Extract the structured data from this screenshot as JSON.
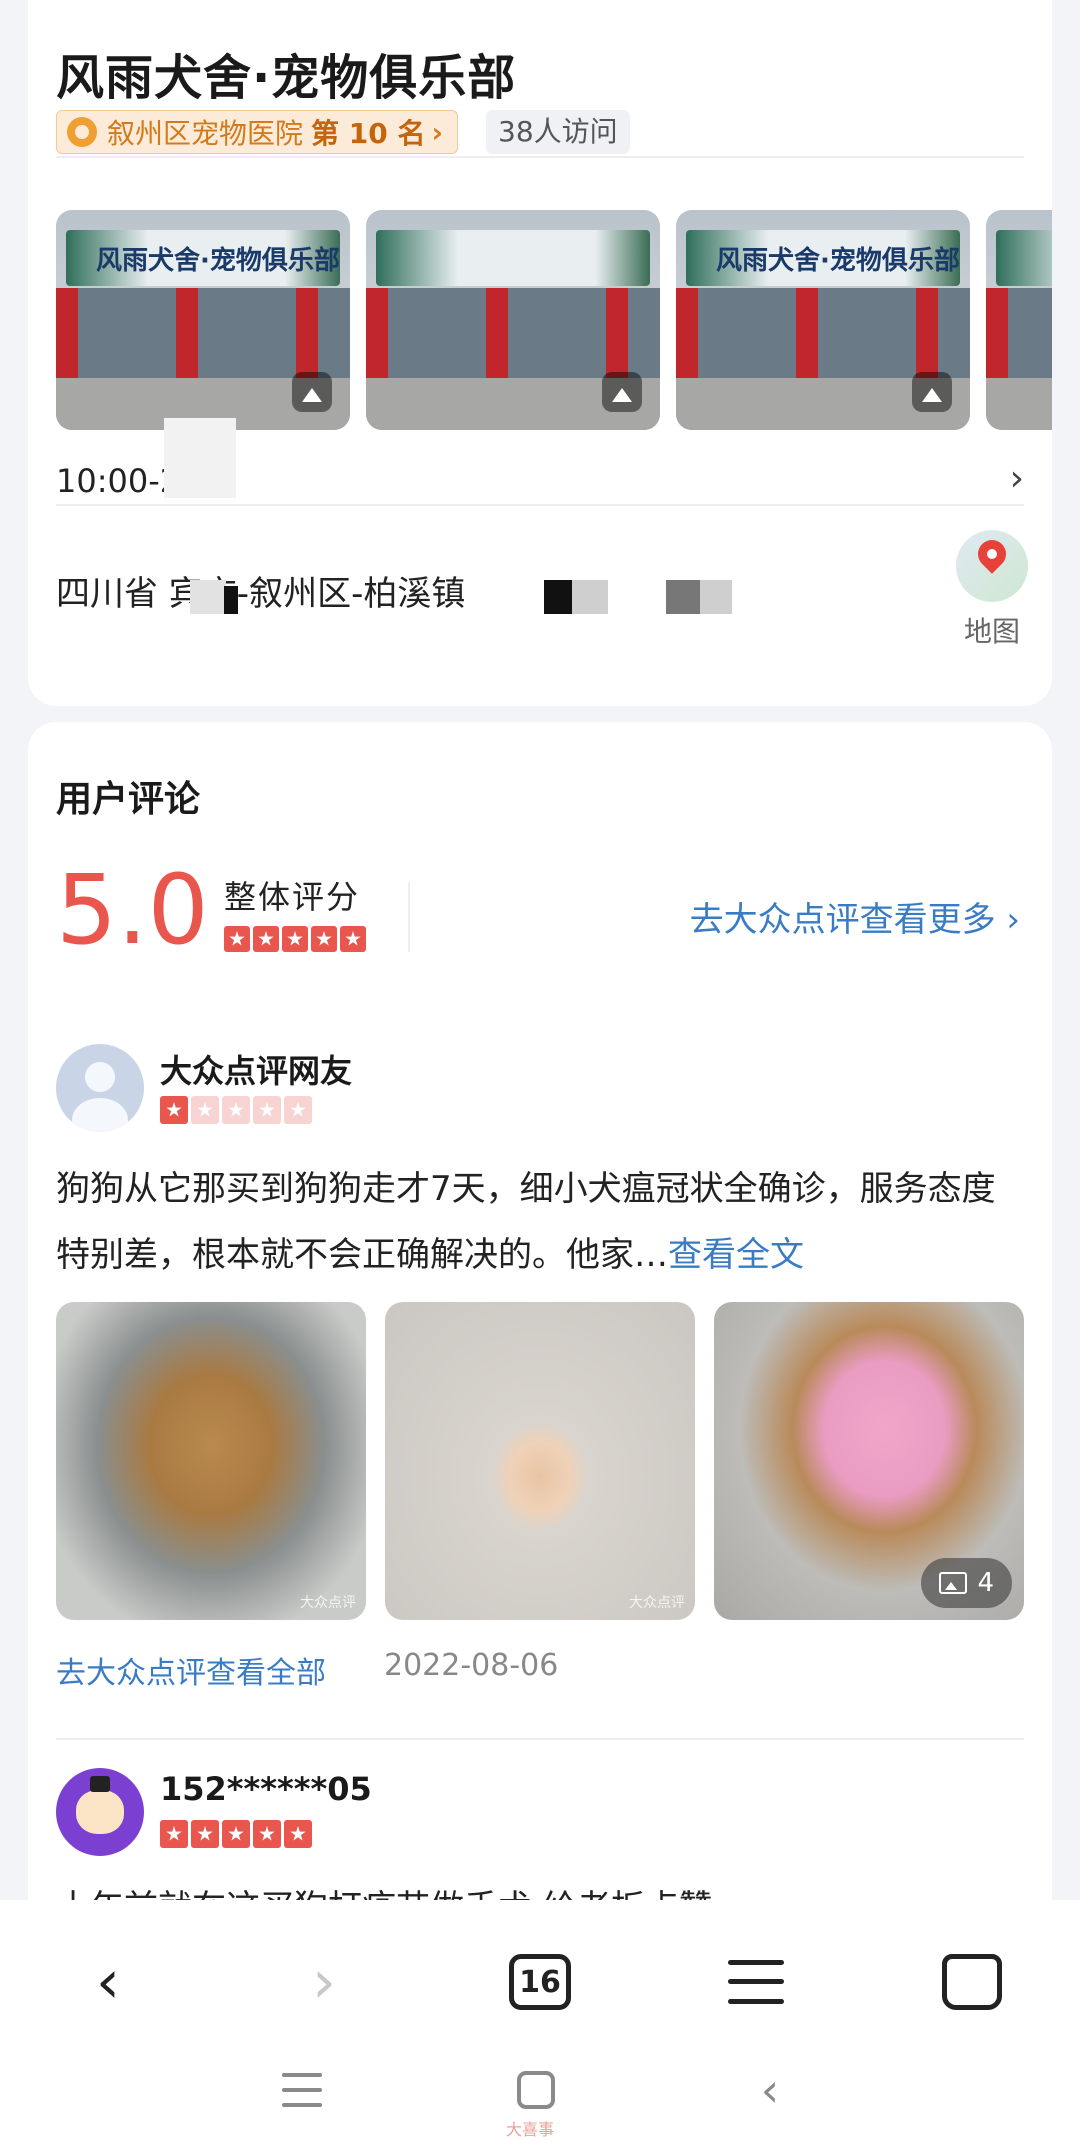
{
  "shop": {
    "title": "风雨犬舍·宠物俱乐部",
    "rank_area": "叙州区宠物医院",
    "rank_num": "第 10 名",
    "rank_chevron": "›",
    "visits": "38人访问",
    "photo_sign_text": "风雨犬舍·宠物俱乐部",
    "hours": "10:00-2",
    "hours_chevron": "›",
    "address": "四川省  宾市-叙州区-柏溪镇",
    "map_label": "地图"
  },
  "reviews_section": {
    "title": "用户评论",
    "score": "5.0",
    "score_label": "整体评分",
    "score_stars": 5,
    "more_link": "去大众点评查看更多 ›"
  },
  "reviews": [
    {
      "user": "大众点评网友",
      "stars": 1,
      "text": "狗狗从它那买到狗狗走才7天，细小犬瘟冠状全确诊，服务态度特别差，根本就不会正确解决的。他家…",
      "read_more": "查看全文",
      "photo_watermark": "大众点评",
      "photo_count": "4",
      "footer_link": "去大众点评查看全部",
      "date": "2022-08-06"
    },
    {
      "user": "152******05",
      "stars": 5,
      "text": "十年前就在这买狗打疫苗做手术 给老板点赞"
    }
  ],
  "browser": {
    "back_glyph": "‹",
    "forward_glyph": "›",
    "tabs_count": "16"
  },
  "system_nav": {
    "back_glyph": "‹"
  },
  "footer_watermark": "大喜事",
  "colors": {
    "accent_red": "#e9564d",
    "link_blue": "#3a7cc4",
    "rank_orange": "#d37a1a"
  }
}
